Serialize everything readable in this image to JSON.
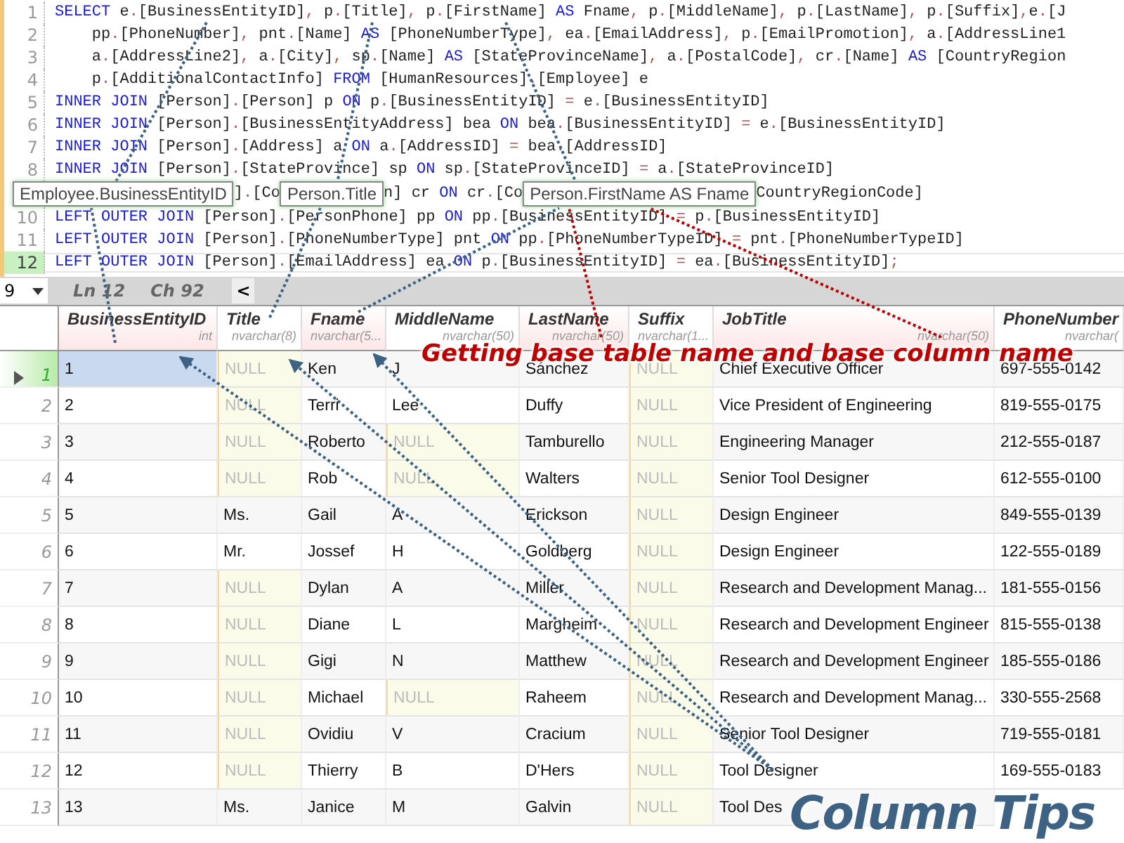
{
  "editor": {
    "lines": [
      {
        "num": "1",
        "text": "SELECT e.[BusinessEntityID], p.[Title], p.[FirstName] AS Fname, p.[MiddleName], p.[LastName], p.[Suffix],e.[J",
        "current": false
      },
      {
        "num": "2",
        "text": "    pp.[PhoneNumber], pnt.[Name] AS [PhoneNumberType], ea.[EmailAddress], p.[EmailPromotion], a.[AddressLine1",
        "current": false
      },
      {
        "num": "3",
        "text": "    a.[AddressLine2], a.[City], sp.[Name] AS [StateProvinceName], a.[PostalCode], cr.[Name] AS [CountryRegion",
        "current": false
      },
      {
        "num": "4",
        "text": "    p.[AdditionalContactInfo] FROM [HumanResources].[Employee] e",
        "current": false
      },
      {
        "num": "5",
        "text": "INNER JOIN [Person].[Person] p ON p.[BusinessEntityID] = e.[BusinessEntityID]",
        "current": false
      },
      {
        "num": "6",
        "text": "INNER JOIN [Person].[BusinessEntityAddress] bea ON bea.[BusinessEntityID] = e.[BusinessEntityID]",
        "current": false
      },
      {
        "num": "7",
        "text": "INNER JOIN [Person].[Address] a ON a.[AddressID] = bea.[AddressID]",
        "current": false
      },
      {
        "num": "8",
        "text": "INNER JOIN [Person].[StateProvince] sp ON sp.[StateProvinceID] = a.[StateProvinceID]",
        "current": false
      },
      {
        "parts": [
          "].[Co",
          "n] cr ON cr.[Co",
          "CountryRegionCode]"
        ]
      },
      {
        "num": "10",
        "text": "LEFT OUTER JOIN [Person].[PersonPhone] pp ON pp.[BusinessEntityID] = p.[BusinessEntityID]",
        "current": false
      },
      {
        "num": "11",
        "text": "LEFT OUTER JOIN [Person].[PhoneNumberType] pnt ON pp.[PhoneNumberTypeID] = pnt.[PhoneNumberTypeID]",
        "current": false
      },
      {
        "num": "12",
        "text": "LEFT OUTER JOIN [Person].[EmailAddress] ea ON p.[BusinessEntityID] = ea.[BusinessEntityID];",
        "current": true
      }
    ],
    "tooltips": [
      "Employee.BusinessEntityID",
      "Person.Title",
      "Person.FirstName AS Fname"
    ]
  },
  "status_bar": {
    "zoom": "9",
    "line": "Ln 12",
    "char": "Ch 92",
    "scroll_left": "<"
  },
  "grid": {
    "columns": [
      {
        "name": "BusinessEntityID",
        "type": "int",
        "highlighted": true
      },
      {
        "name": "Title",
        "type": "nvarchar(8)",
        "highlighted": false
      },
      {
        "name": "Fname",
        "type": "nvarchar(5...",
        "highlighted": true
      },
      {
        "name": "MiddleName",
        "type": "nvarchar(50)",
        "highlighted": false
      },
      {
        "name": "LastName",
        "type": "nvarchar(50)",
        "highlighted": true
      },
      {
        "name": "Suffix",
        "type": "nvarchar(1...",
        "highlighted": false
      },
      {
        "name": "JobTitle",
        "type": "nvarchar(50)",
        "highlighted": true
      },
      {
        "name": "PhoneNumber",
        "type": "nvarchar(",
        "highlighted": false
      }
    ],
    "rows": [
      {
        "num": "1",
        "selected": true,
        "cells": [
          "1",
          {
            "null": true,
            "v": "NULL"
          },
          "Ken",
          "J",
          "Sánchez",
          {
            "null": true,
            "v": "NULL"
          },
          "Chief Executive Officer",
          "697-555-0142"
        ]
      },
      {
        "num": "2",
        "selected": false,
        "cells": [
          "2",
          {
            "null": true,
            "v": "NULL"
          },
          "Terri",
          "Lee",
          "Duffy",
          {
            "null": true,
            "v": "NULL"
          },
          "Vice President of Engineering",
          "819-555-0175"
        ]
      },
      {
        "num": "3",
        "selected": false,
        "cells": [
          "3",
          {
            "null": true,
            "v": "NULL"
          },
          "Roberto",
          {
            "null": true,
            "v": "NULL"
          },
          "Tamburello",
          {
            "null": true,
            "v": "NULL"
          },
          "Engineering Manager",
          "212-555-0187"
        ]
      },
      {
        "num": "4",
        "selected": false,
        "cells": [
          "4",
          {
            "null": true,
            "v": "NULL"
          },
          "Rob",
          {
            "null": true,
            "v": "NULL"
          },
          "Walters",
          {
            "null": true,
            "v": "NULL"
          },
          "Senior Tool Designer",
          "612-555-0100"
        ]
      },
      {
        "num": "5",
        "selected": false,
        "cells": [
          "5",
          "Ms.",
          "Gail",
          "A",
          "Erickson",
          {
            "null": true,
            "v": "NULL"
          },
          "Design Engineer",
          "849-555-0139"
        ]
      },
      {
        "num": "6",
        "selected": false,
        "cells": [
          "6",
          "Mr.",
          "Jossef",
          "H",
          "Goldberg",
          {
            "null": true,
            "v": "NULL"
          },
          "Design Engineer",
          "122-555-0189"
        ]
      },
      {
        "num": "7",
        "selected": false,
        "cells": [
          "7",
          {
            "null": true,
            "v": "NULL"
          },
          "Dylan",
          "A",
          "Miller",
          {
            "null": true,
            "v": "NULL"
          },
          "Research and Development Manag...",
          "181-555-0156"
        ]
      },
      {
        "num": "8",
        "selected": false,
        "cells": [
          "8",
          {
            "null": true,
            "v": "NULL"
          },
          "Diane",
          "L",
          "Margheim",
          {
            "null": true,
            "v": "NULL"
          },
          "Research and Development Engineer",
          "815-555-0138"
        ]
      },
      {
        "num": "9",
        "selected": false,
        "cells": [
          "9",
          {
            "null": true,
            "v": "NULL"
          },
          "Gigi",
          "N",
          "Matthew",
          {
            "null": true,
            "v": "NULL"
          },
          "Research and Development Engineer",
          "185-555-0186"
        ]
      },
      {
        "num": "10",
        "selected": false,
        "cells": [
          "10",
          {
            "null": true,
            "v": "NULL"
          },
          "Michael",
          {
            "null": true,
            "v": "NULL"
          },
          "Raheem",
          {
            "null": true,
            "v": "NULL"
          },
          "Research and Development Manag...",
          "330-555-2568"
        ]
      },
      {
        "num": "11",
        "selected": false,
        "cells": [
          "11",
          {
            "null": true,
            "v": "NULL"
          },
          "Ovidiu",
          "V",
          "Cracium",
          {
            "null": true,
            "v": "NULL"
          },
          "Senior Tool Designer",
          "719-555-0181"
        ]
      },
      {
        "num": "12",
        "selected": false,
        "cells": [
          "12",
          {
            "null": true,
            "v": "NULL"
          },
          "Thierry",
          "B",
          "D'Hers",
          {
            "null": true,
            "v": "NULL"
          },
          "Tool Designer",
          "169-555-0183"
        ]
      },
      {
        "num": "13",
        "selected": false,
        "cells": [
          "13",
          "Ms.",
          "Janice",
          "M",
          "Galvin",
          {
            "null": true,
            "v": "NULL"
          },
          "Tool Des"
        ]
      }
    ]
  },
  "annotations": [
    {
      "kind": "heading",
      "text": "Getting base table name and base column name"
    },
    {
      "kind": "callout",
      "text": "Column Tips"
    }
  ]
}
